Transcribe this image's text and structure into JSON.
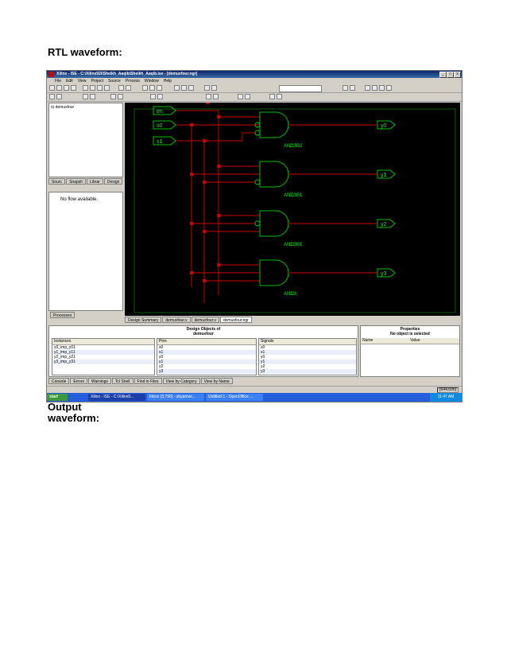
{
  "document": {
    "heading_rtl": "RTL waveform:",
    "heading_output_1": "Output",
    "heading_output_2": "waveform:"
  },
  "window": {
    "title": "Xilinx - ISE - C:\\Xilinx92i\\Sheikh_Aaqib\\Sheikh_Aaqib.ise - [demuxfour.ngr]",
    "controls": [
      "_",
      "□",
      "x"
    ]
  },
  "menu": [
    "File",
    "Edit",
    "View",
    "Project",
    "Source",
    "Process",
    "Window",
    "Help"
  ],
  "sources_panel": {
    "tree_item": "demuxfour",
    "tabs": [
      "Sourc",
      "Snapsh",
      "Librar",
      "Design"
    ]
  },
  "process_panel": {
    "message": "No flow available.",
    "tab": "Processes"
  },
  "editor_tabs": [
    "Design Summary",
    "demuxfour.v",
    "demuxfour.v",
    "demuxfour.ngr"
  ],
  "schematic": {
    "inputs": [
      "en",
      "s0",
      "s1"
    ],
    "outputs": [
      "y0",
      "y1",
      "y2",
      "y3"
    ],
    "gates": [
      "AND3B2",
      "AND3B1",
      "AND3B1",
      "AND3"
    ],
    "colors": {
      "bg": "#000000",
      "wire": "#cc0000",
      "gate": "#00c000",
      "label": "#00ff00"
    }
  },
  "design_objects": {
    "title_line1": "Design Objects of",
    "title_line2": "demuxfour",
    "instances_header": "Instances",
    "instances": [
      "y0_imp_y01",
      "y1_imp_y11",
      "y2_imp_y21",
      "y3_imp_y31"
    ],
    "pins_header": "Pins",
    "pins": [
      "s0",
      "s1",
      "y0",
      "y1",
      "y2",
      "y3"
    ],
    "signals_header": "Signals",
    "signals": [
      "s0",
      "s1",
      "y0",
      "y1",
      "y2",
      "y3"
    ]
  },
  "properties": {
    "title": "Properties",
    "subtitle": "No object is selected",
    "col_name": "Name",
    "col_value": "Value"
  },
  "bottom_tabs": [
    "Console",
    "Errors",
    "Warnings",
    "Tcl Shell",
    "Find in Files",
    "View by Category",
    "View by Name"
  ],
  "status": {
    "coords": "[644,696]"
  },
  "taskbar": {
    "start": "start",
    "items": [
      "Xilinx - ISE - C:\\Xilinx9...",
      "Inbox (3,790) - shyamve...",
      "Untitled 1 - OpenOffice ..."
    ],
    "clock": "11:47 AM"
  }
}
